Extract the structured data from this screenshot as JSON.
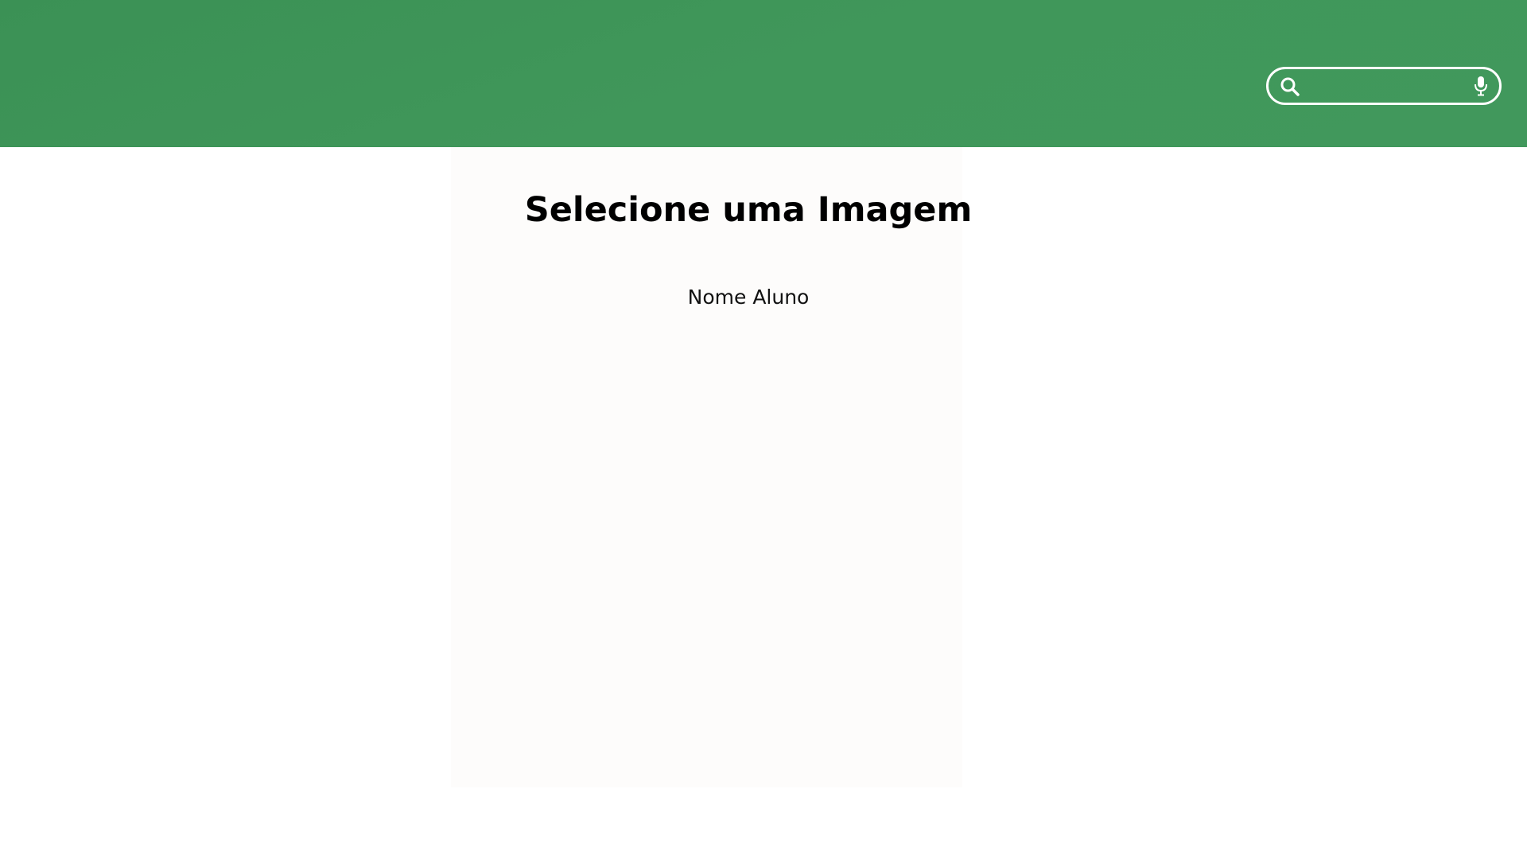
{
  "header": {
    "background_color": "#40975a"
  },
  "search": {
    "value": "",
    "placeholder": "",
    "icon": "search-icon",
    "mic_icon": "microphone-icon"
  },
  "main": {
    "title": "Selecione uma Imagem",
    "student_name": "Nome Aluno"
  }
}
